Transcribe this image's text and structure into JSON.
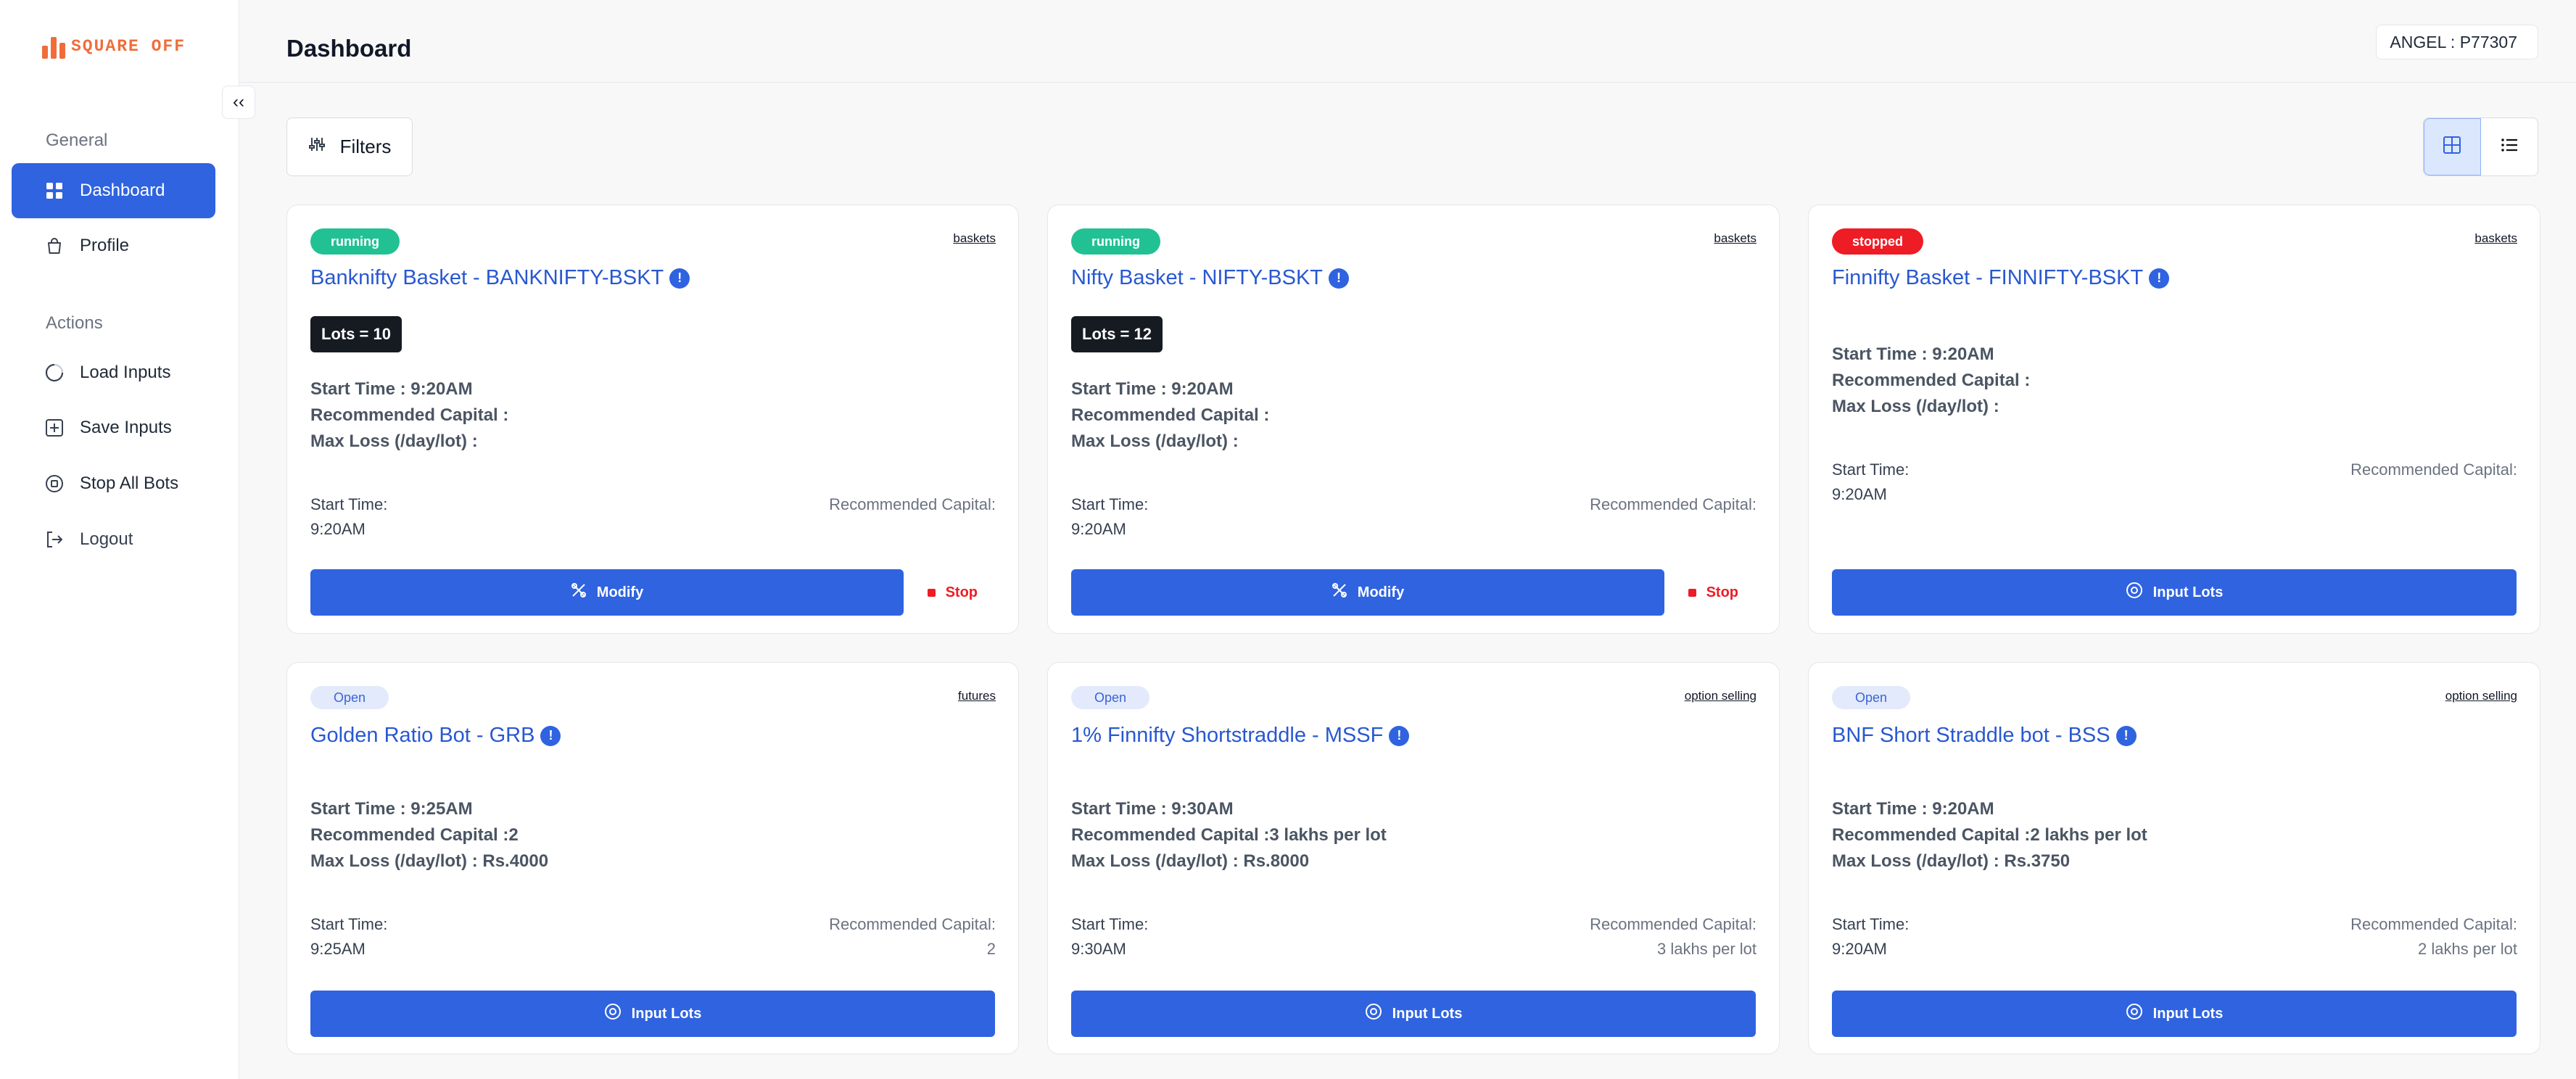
{
  "app": {
    "logo_text": "SQUARE OFF",
    "collapse_glyph": "‹‹"
  },
  "sidebar": {
    "general_title": "General",
    "actions_title": "Actions",
    "general_items": [
      {
        "label": "Dashboard",
        "icon": "grid-icon",
        "active": true
      },
      {
        "label": "Profile",
        "icon": "bag-icon",
        "active": false
      }
    ],
    "action_items": [
      {
        "label": "Load Inputs",
        "icon": "loader-icon"
      },
      {
        "label": "Save Inputs",
        "icon": "plus-square-icon"
      },
      {
        "label": "Stop All Bots",
        "icon": "stop-circle-icon"
      },
      {
        "label": "Logout",
        "icon": "logout-icon"
      }
    ]
  },
  "header": {
    "title": "Dashboard",
    "account": "ANGEL : P77307"
  },
  "toolbar": {
    "filters_label": "Filters",
    "view_grid_icon": "grid-view-icon",
    "view_list_icon": "list-view-icon"
  },
  "colors": {
    "accent": "#2f63e0",
    "running": "#22c194",
    "stopped": "#ee1c25",
    "open_bg": "#e3eafb"
  },
  "cards": [
    {
      "status": "running",
      "category": "baskets",
      "title": "Banknifty Basket - BANKNIFTY-BSKT",
      "lots": "Lots = 10",
      "start_time": "Start Time : 9:20AM",
      "recommended_capital": "Recommended Capital :",
      "max_loss": "Max Loss (/day/lot) :",
      "foot_start_label": "Start Time:",
      "foot_start_value": "9:20AM",
      "foot_capital_label": "Recommended Capital:",
      "foot_capital_value": "",
      "action_label": "Modify",
      "stop_label": "Stop"
    },
    {
      "status": "running",
      "category": "baskets",
      "title": "Nifty Basket - NIFTY-BSKT",
      "lots": "Lots = 12",
      "start_time": "Start Time : 9:20AM",
      "recommended_capital": "Recommended Capital :",
      "max_loss": "Max Loss (/day/lot) :",
      "foot_start_label": "Start Time:",
      "foot_start_value": "9:20AM",
      "foot_capital_label": "Recommended Capital:",
      "foot_capital_value": "",
      "action_label": "Modify",
      "stop_label": "Stop"
    },
    {
      "status": "stopped",
      "category": "baskets",
      "title": "Finnifty Basket - FINNIFTY-BSKT",
      "lots": "",
      "start_time": "Start Time : 9:20AM",
      "recommended_capital": "Recommended Capital :",
      "max_loss": "Max Loss (/day/lot) :",
      "foot_start_label": "Start Time:",
      "foot_start_value": "9:20AM",
      "foot_capital_label": "Recommended Capital:",
      "foot_capital_value": "",
      "action_label": "Input Lots",
      "stop_label": ""
    },
    {
      "status": "Open",
      "category": "futures",
      "title": "Golden Ratio Bot - GRB",
      "lots": "",
      "start_time": "Start Time : 9:25AM",
      "recommended_capital": "Recommended Capital :2",
      "max_loss": "Max Loss (/day/lot) : Rs.4000",
      "foot_start_label": "Start Time:",
      "foot_start_value": "9:25AM",
      "foot_capital_label": "Recommended Capital:",
      "foot_capital_value": "2",
      "action_label": "Input Lots",
      "stop_label": ""
    },
    {
      "status": "Open",
      "category": "option selling",
      "title": "1% Finnifty Shortstraddle - MSSF",
      "lots": "",
      "start_time": "Start Time : 9:30AM",
      "recommended_capital": "Recommended Capital :3 lakhs per lot",
      "max_loss": "Max Loss (/day/lot) : Rs.8000",
      "foot_start_label": "Start Time:",
      "foot_start_value": "9:30AM",
      "foot_capital_label": "Recommended Capital:",
      "foot_capital_value": "3 lakhs per lot",
      "action_label": "Input Lots",
      "stop_label": ""
    },
    {
      "status": "Open",
      "category": "option selling",
      "title": "BNF Short Straddle bot - BSS",
      "lots": "",
      "start_time": "Start Time : 9:20AM",
      "recommended_capital": "Recommended Capital :2 lakhs per lot",
      "max_loss": "Max Loss (/day/lot) : Rs.3750",
      "foot_start_label": "Start Time:",
      "foot_start_value": "9:20AM",
      "foot_capital_label": "Recommended Capital:",
      "foot_capital_value": "2 lakhs per lot",
      "action_label": "Input Lots",
      "stop_label": ""
    }
  ]
}
